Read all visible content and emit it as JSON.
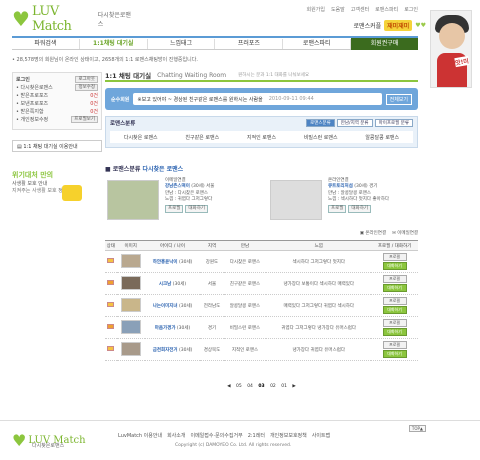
{
  "brand": {
    "name": "LUV Match",
    "tagline": "다시찾은로맨스"
  },
  "top_nav": [
    "회원가입",
    "도움말",
    "고객센터",
    "로맨스파티",
    "로그인"
  ],
  "promo": {
    "text": "로맨스커플",
    "highlight": "재미재미"
  },
  "avatar": {
    "tag": "앗!미"
  },
  "main_nav": [
    {
      "label": "파워검색",
      "active": false
    },
    {
      "label": "1:1채팅 대기실",
      "active": true
    },
    {
      "label": "느낌태그",
      "active": false
    },
    {
      "label": "프러포즈",
      "active": false
    },
    {
      "label": "로맨스파티",
      "active": false
    },
    {
      "label": "회원권구매",
      "active": false
    }
  ],
  "notice": "• 28,578명의 회원님이 온라인 상태이고, 2658개의 1:1 로맨스채팅방이 진행중입니다.",
  "sidebar": {
    "user_title": "로그인",
    "login_btn": "로그아웃",
    "profile_btn": "정보수정",
    "lines": [
      {
        "label": "• 다시찾은로맨스",
        "value": ""
      },
      {
        "label": "• 받은프로포즈",
        "value": "0건"
      },
      {
        "label": "• 보낸프로포즈",
        "value": "0건"
      },
      {
        "label": "• 받은쪽지함",
        "value": "0건"
      },
      {
        "label": "• 개인정보수정",
        "value": ""
      }
    ],
    "extra_btn": "프로필보기",
    "help_link": "1:1 채팅 대기실 이용안내",
    "promo_big": "위기대처 만의",
    "promo_line": "사생활 보호 안내",
    "promo_small": "지켜주는 사생활 보호 정책"
  },
  "content": {
    "title": "1:1 채팅 대기실",
    "title_en": "Chatting Waiting Room",
    "desc": "원하시는 분과 1:1 대화를 나눠보세요",
    "live": {
      "label": "순수회원",
      "message": "※보고 있어야 ~ 경상된 친구같은 로맨스를 원하시는 사람을",
      "time": "2010-09-11 09:44",
      "more": "전체보기"
    },
    "category": {
      "title": "로맨스분류",
      "tabs": [
        "로맨스분류",
        "만남/지역 분류",
        "마이프로필 분류"
      ],
      "items": [
        "다시찾은 로맨스",
        "친구같은 로맨스",
        "지적인 로맨스",
        "비밀스런 로맨스",
        "알콩달콩 로맨스"
      ]
    },
    "section_title": "로맨스분류",
    "section_sub": "다시찾은 로맨스",
    "cards": [
      {
        "status": "이메일연결",
        "nick": "강남츤스떡이",
        "age": "(30세)",
        "region": "서울",
        "meet": "만남 : 다시찾은 로맨스",
        "feel": "느낌 : 귀엽다 그저그렇다",
        "btn1": "프로필",
        "btn2": "대화하기"
      },
      {
        "status": "온라인연결",
        "nick": "큐트토리처섬",
        "age": "(30세)",
        "region": "경기",
        "meet": "만남 : 알콩달콩 로맨스",
        "feel": "느낌 : 섹시하다 멋지다 좋아하다",
        "btn1": "프로필",
        "btn2": "대화하기"
      }
    ],
    "legend": [
      "온라인연결",
      "이메일연결"
    ],
    "table": {
      "headers": [
        "상태",
        "이미지",
        "아이디 / 나이",
        "지역",
        "만남",
        "느낌",
        "프로필 / 대화하기"
      ],
      "rows": [
        {
          "nick": "하얀홍윤낙이",
          "age": "(30세)",
          "region": "강원도",
          "meet": "다시찾은 로맨스",
          "feel": "섹시하다 그저그렇다 멋지다",
          "btn1": "프로필",
          "btn2": "대화하기"
        },
        {
          "nick": "시크남",
          "age": "(30세)",
          "region": "서울",
          "meet": "친구같은 로맨스",
          "feel": "냉가장다 보통이다 섹시하다 매력있다",
          "btn1": "프로필",
          "btn2": "대화하기"
        },
        {
          "nick": "나는이미지녀",
          "age": "(30세)",
          "region": "전라남도",
          "meet": "알콩달콩 로맨스",
          "feel": "매력있다 그저그렇다 귀엽다 섹시하다",
          "btn1": "프로필",
          "btn2": "대화하기"
        },
        {
          "nick": "마음가경가",
          "age": "(30세)",
          "region": "경기",
          "meet": "비밀스런 로맨스",
          "feel": "귀엽다 그저그렇다 냉가장다 유머스럽다",
          "btn1": "프로필",
          "btn2": "대화하기"
        },
        {
          "nick": "금천회자전거",
          "age": "(30세)",
          "region": "경상북도",
          "meet": "지적인 로맨스",
          "feel": "냉가장다 귀엽다 유머스럽다",
          "btn1": "프로필",
          "btn2": "대화하기"
        }
      ]
    },
    "pager": {
      "prev": "◀",
      "pages": [
        "05",
        "04",
        "03",
        "02",
        "01"
      ],
      "current": "03",
      "next": "▶"
    }
  },
  "footer": {
    "links": [
      "LuvMatch 이용안내",
      "회사소개",
      "이메일접수·문의수집거부",
      "2:1레터",
      "개인정보보호정책",
      "사이트맵"
    ],
    "copyright": "Copyright (c) DAMOYEO Co. Ltd. All rights reserved.",
    "top": "TOP▲"
  }
}
